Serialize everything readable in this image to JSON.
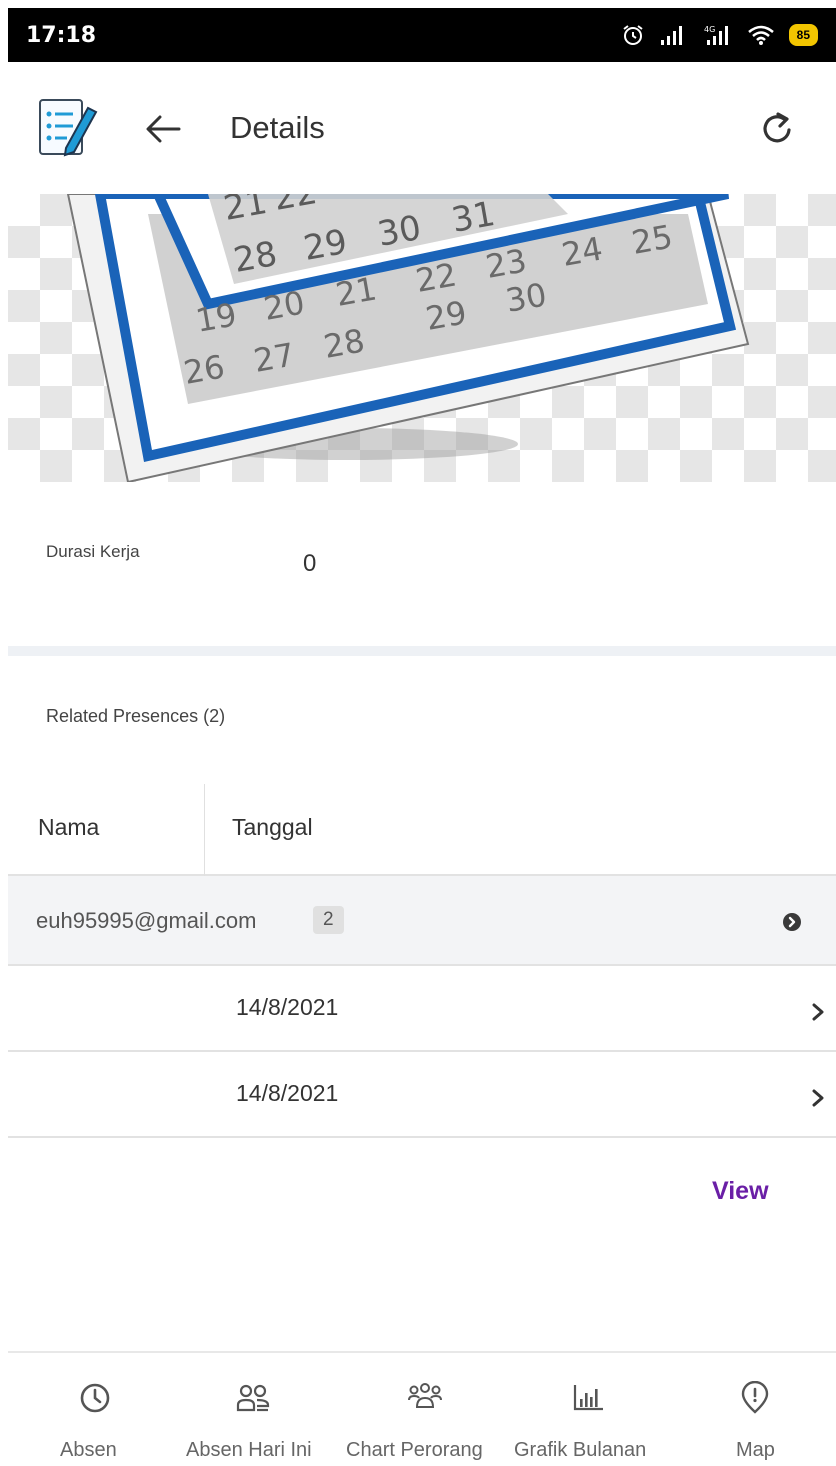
{
  "status_bar": {
    "time": "17:18",
    "battery_level": "85"
  },
  "app_bar": {
    "title": "Details",
    "icons": [
      "checklist-logo-icon",
      "arrow-left-icon",
      "refresh-icon"
    ]
  },
  "hero": {
    "calendar_numbers_top": [
      "21",
      "22",
      "28",
      "29",
      "30",
      "31"
    ],
    "calendar_numbers_bottom": [
      "19",
      "20",
      "21",
      "22",
      "23",
      "24",
      "25",
      "26",
      "27",
      "28",
      "29",
      "30"
    ]
  },
  "detail": {
    "label": "Durasi Kerja",
    "value": "0"
  },
  "related": {
    "title": "Related Presences (2)",
    "columns": [
      "Nama",
      "Tanggal"
    ],
    "group": {
      "email": "euh95995@gmail.com",
      "count": "2"
    },
    "rows": [
      {
        "date": "14/8/2021"
      },
      {
        "date": "14/8/2021"
      }
    ],
    "view_label": "View"
  },
  "bottom_nav": {
    "items": [
      {
        "label": "Absen",
        "icon": "clock-icon"
      },
      {
        "label": "Absen Hari Ini",
        "icon": "people-icon"
      },
      {
        "label": "Chart Perorang",
        "icon": "group-icon"
      },
      {
        "label": "Grafik Bulanan",
        "icon": "bar-chart-icon"
      },
      {
        "label": "Map",
        "icon": "map-pin-icon"
      }
    ]
  },
  "colors": {
    "accent": "#6a1fa6",
    "calendar_blue": "#1a63b8",
    "row_group_bg": "#f3f4f6"
  }
}
